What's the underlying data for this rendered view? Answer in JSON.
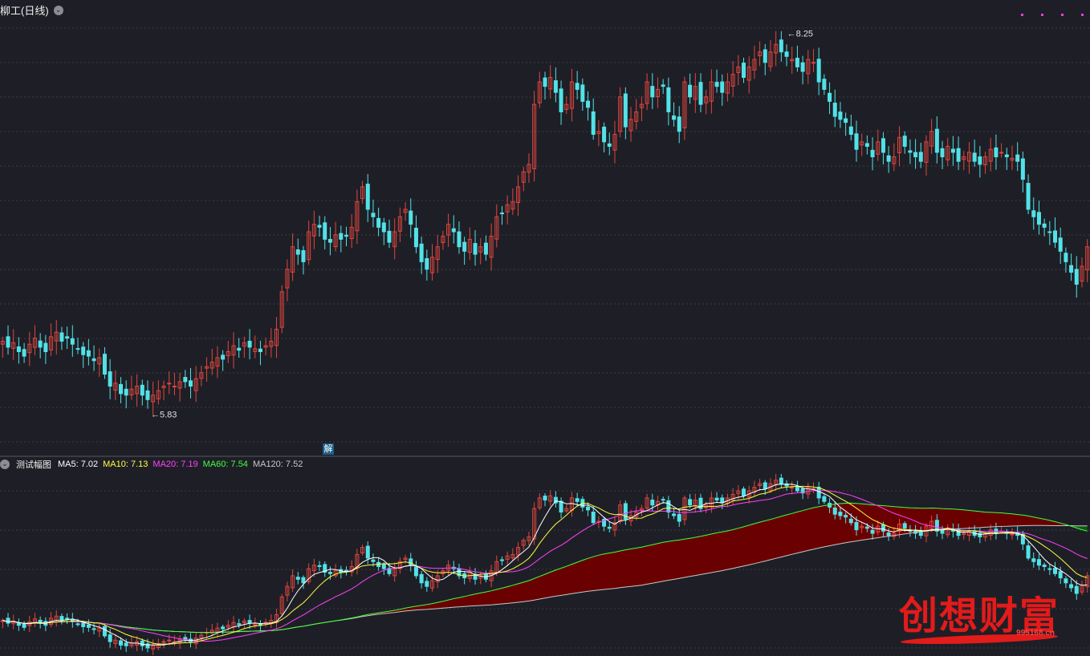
{
  "header": {
    "title": "柳工(日线)",
    "collapse_icon": "chevron-down-icon"
  },
  "annotations": {
    "high": "8.25",
    "low": "5.83",
    "badge": "解"
  },
  "indicator": {
    "name": "测试幅图",
    "ma": [
      {
        "label": "MA5:",
        "value": "7.02",
        "color": "#ffffff"
      },
      {
        "label": "MA10:",
        "value": "7.13",
        "color": "#ffff40"
      },
      {
        "label": "MA20:",
        "value": "7.19",
        "color": "#ff40ff"
      },
      {
        "label": "MA60:",
        "value": "7.54",
        "color": "#40ff40"
      },
      {
        "label": "MA120:",
        "value": "7.52",
        "color": "#c8c8c8"
      }
    ]
  },
  "colors": {
    "up": "#e0453e",
    "down": "#52e2e8",
    "bg": "#1e1f26",
    "grid": "#3a3b44",
    "band_up": "#6b0000",
    "band_down": "#0e5a12"
  },
  "watermark": {
    "text": "创想财富",
    "url": "995168.cn"
  },
  "chart_data": {
    "type": "candlestick",
    "price_range": [
      5.5,
      8.4
    ],
    "ma_label_values": {
      "MA5": 7.02,
      "MA10": 7.13,
      "MA20": 7.19,
      "MA60": 7.54,
      "MA120": 7.52
    },
    "closes": [
      6.22,
      6.18,
      6.21,
      6.15,
      6.12,
      6.2,
      6.24,
      6.18,
      6.15,
      6.25,
      6.28,
      6.22,
      6.24,
      6.2,
      6.17,
      6.13,
      6.12,
      6.09,
      6.11,
      6.0,
      5.92,
      5.94,
      5.87,
      5.86,
      5.9,
      5.92,
      5.86,
      5.83,
      5.86,
      5.89,
      5.92,
      5.94,
      5.92,
      5.95,
      5.95,
      5.92,
      5.97,
      6.01,
      6.05,
      6.08,
      6.11,
      6.1,
      6.15,
      6.19,
      6.16,
      6.21,
      6.18,
      6.17,
      6.15,
      6.19,
      6.22,
      6.3,
      6.55,
      6.7,
      6.85,
      6.8,
      6.75,
      6.95,
      7.0,
      6.98,
      6.9,
      6.88,
      6.93,
      6.9,
      6.92,
      6.98,
      7.15,
      7.25,
      7.1,
      7.05,
      6.98,
      6.95,
      6.88,
      6.95,
      7.05,
      7.1,
      7.0,
      6.85,
      6.75,
      6.7,
      6.78,
      6.85,
      6.92,
      7.0,
      6.95,
      6.85,
      6.82,
      6.9,
      6.8,
      6.85,
      6.8,
      6.92,
      7.05,
      7.07,
      7.13,
      7.15,
      7.25,
      7.35,
      7.4,
      7.8,
      7.95,
      7.92,
      7.98,
      7.88,
      7.75,
      7.8,
      7.95,
      7.9,
      7.82,
      7.78,
      7.6,
      7.62,
      7.55,
      7.52,
      7.6,
      7.85,
      7.65,
      7.7,
      7.75,
      7.8,
      7.95,
      7.85,
      7.9,
      7.92,
      7.75,
      7.7,
      7.62,
      7.95,
      7.85,
      7.92,
      7.8,
      7.85,
      7.95,
      7.92,
      7.88,
      7.95,
      8.0,
      8.05,
      7.98,
      8.05,
      8.1,
      8.15,
      8.08,
      8.15,
      8.2,
      8.15,
      8.12,
      8.1,
      8.05,
      8.02,
      8.1,
      8.08,
      7.95,
      7.9,
      7.82,
      7.72,
      7.7,
      7.68,
      7.6,
      7.5,
      7.55,
      7.52,
      7.45,
      7.55,
      7.48,
      7.42,
      7.45,
      7.58,
      7.52,
      7.48,
      7.45,
      7.42,
      7.55,
      7.62,
      7.48,
      7.45,
      7.52,
      7.48,
      7.42,
      7.45,
      7.48,
      7.42,
      7.4,
      7.45,
      7.5,
      7.45,
      7.48,
      7.45,
      7.44,
      7.42,
      7.3,
      7.1,
      7.05,
      7.0,
      6.98,
      6.95,
      6.88,
      6.82,
      6.75,
      6.68,
      6.6,
      6.72,
      6.85
    ]
  }
}
